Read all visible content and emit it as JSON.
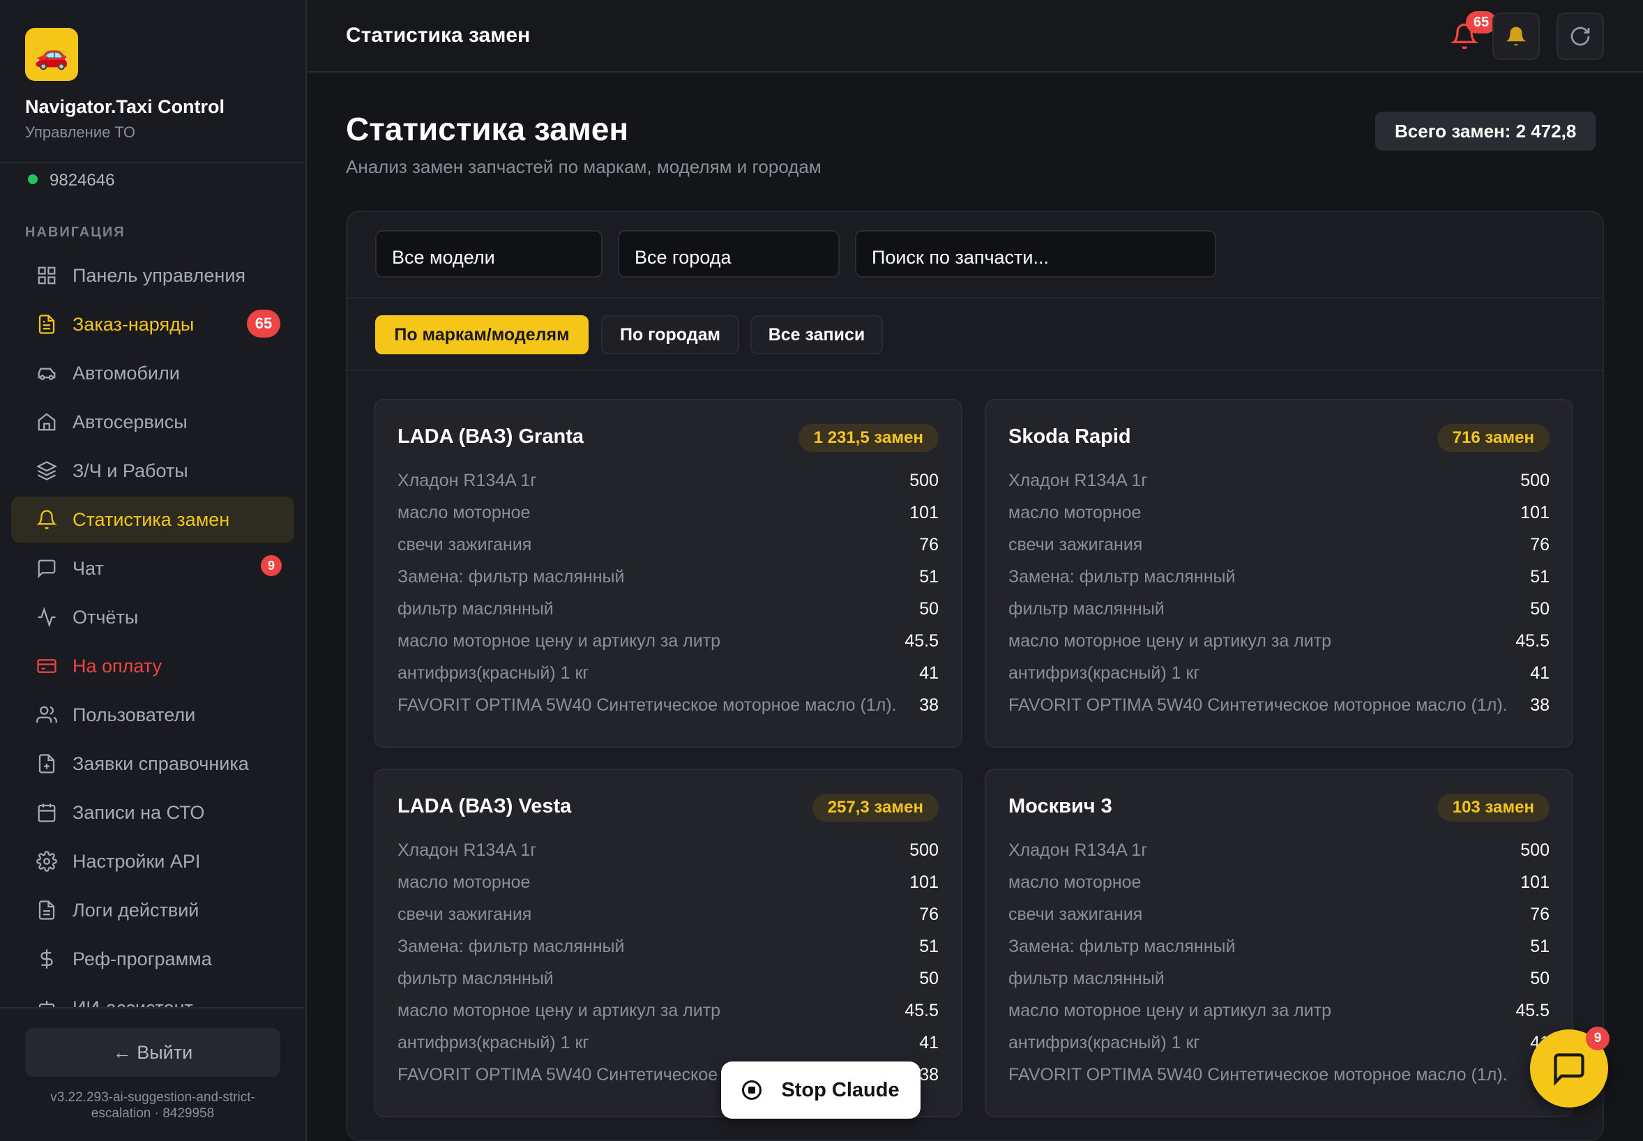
{
  "app": {
    "logo_emoji": "🚗",
    "name": "Navigator.Taxi Control",
    "subtitle": "Управление ТО",
    "user_id": "9824646"
  },
  "sidebar": {
    "section_title": "НАВИГАЦИЯ",
    "items": [
      {
        "label": "Панель управления",
        "icon": "grid-icon"
      },
      {
        "label": "Заказ-наряды",
        "icon": "document-icon",
        "badge": "65"
      },
      {
        "label": "Автомобили",
        "icon": "car-icon"
      },
      {
        "label": "Автосервисы",
        "icon": "home-icon"
      },
      {
        "label": "З/Ч и Работы",
        "icon": "layers-icon"
      },
      {
        "label": "Статистика замен",
        "icon": "bell-icon"
      },
      {
        "label": "Чат",
        "icon": "chat-icon",
        "badge": "9"
      },
      {
        "label": "Отчёты",
        "icon": "activity-icon"
      },
      {
        "label": "На оплату",
        "icon": "credit-card-icon"
      },
      {
        "label": "Пользователи",
        "icon": "users-icon"
      },
      {
        "label": "Заявки справочника",
        "icon": "file-plus-icon"
      },
      {
        "label": "Записи на СТО",
        "icon": "calendar-icon"
      },
      {
        "label": "Настройки API",
        "icon": "gear-icon"
      },
      {
        "label": "Логи действий",
        "icon": "log-icon"
      },
      {
        "label": "Реф-программа",
        "icon": "dollar-icon"
      },
      {
        "label": "ИИ-ассистент",
        "icon": "bot-icon"
      }
    ],
    "logout": "← Выйти",
    "version": "v3.22.293-ai-suggestion-and-strict-escalation · 8429958"
  },
  "topbar": {
    "title": "Статистика замен",
    "notif_count": "65"
  },
  "page": {
    "title": "Статистика замен",
    "subtitle": "Анализ замен запчастей по маркам, моделям и городам",
    "total": "Всего замен: 2 472,8"
  },
  "filters": {
    "model": "Все модели",
    "city": "Все города",
    "search": "Поиск по запчасти..."
  },
  "tabs": [
    "По маркам/моделям",
    "По городам",
    "Все записи"
  ],
  "cards": [
    {
      "title": "LADA (ВАЗ) Granta",
      "badge": "1 231,5 замен",
      "rows": [
        [
          "Хладон R134A 1г",
          "500"
        ],
        [
          "масло моторное",
          "101"
        ],
        [
          "свечи зажигания",
          "76"
        ],
        [
          "Замена: фильтр маслянный",
          "51"
        ],
        [
          "фильтр маслянный",
          "50"
        ],
        [
          "масло моторное цену и артикул за литр",
          "45.5"
        ],
        [
          "антифриз(красный) 1 кг",
          "41"
        ],
        [
          "FAVORIT OPTIMA 5W40 Синтетическое моторное масло (1л).",
          "38"
        ]
      ]
    },
    {
      "title": "Skoda Rapid",
      "badge": "716 замен",
      "rows": [
        [
          "Хладон R134A 1г",
          "500"
        ],
        [
          "масло моторное",
          "101"
        ],
        [
          "свечи зажигания",
          "76"
        ],
        [
          "Замена: фильтр маслянный",
          "51"
        ],
        [
          "фильтр маслянный",
          "50"
        ],
        [
          "масло моторное цену и артикул за литр",
          "45.5"
        ],
        [
          "антифриз(красный) 1 кг",
          "41"
        ],
        [
          "FAVORIT OPTIMA 5W40 Синтетическое моторное масло (1л).",
          "38"
        ]
      ]
    },
    {
      "title": "LADA (ВАЗ) Vesta",
      "badge": "257,3 замен",
      "rows": [
        [
          "Хладон R134A 1г",
          "500"
        ],
        [
          "масло моторное",
          "101"
        ],
        [
          "свечи зажигания",
          "76"
        ],
        [
          "Замена: фильтр маслянный",
          "51"
        ],
        [
          "фильтр маслянный",
          "50"
        ],
        [
          "масло моторное цену и артикул за литр",
          "45.5"
        ],
        [
          "антифриз(красный) 1 кг",
          "41"
        ],
        [
          "FAVORIT OPTIMA 5W40 Синтетическое моторное масло (1л).",
          "38"
        ]
      ]
    },
    {
      "title": "Москвич 3",
      "badge": "103 замен",
      "rows": [
        [
          "Хладон R134A 1г",
          "500"
        ],
        [
          "масло моторное",
          "101"
        ],
        [
          "свечи зажигания",
          "76"
        ],
        [
          "Замена: фильтр маслянный",
          "51"
        ],
        [
          "фильтр маслянный",
          "50"
        ],
        [
          "масло моторное цену и артикул за литр",
          "45.5"
        ],
        [
          "антифриз(красный) 1 кг",
          "41"
        ],
        [
          "FAVORIT OPTIMA 5W40 Синтетическое моторное масло (1л).",
          "38"
        ]
      ]
    }
  ],
  "overlay": {
    "stop": "Stop Claude",
    "chat_badge": "9"
  },
  "colors": {
    "accent": "#f5c518",
    "danger": "#ef4444",
    "online": "#22c55e",
    "bg": "#141519"
  }
}
